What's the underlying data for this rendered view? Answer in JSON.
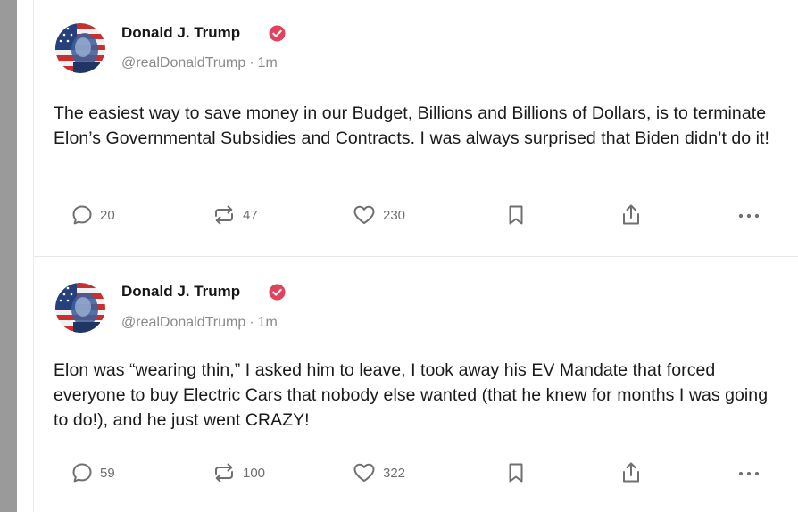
{
  "posts": [
    {
      "author_name": "Donald J. Trump",
      "handle": "@realDonaldTrump",
      "separator": "·",
      "time": "1m",
      "text": "The easiest way to save money in our Budget, Billions and Billions of Dollars, is to terminate Elon’s Governmental Subsidies and Contracts. I was always surprised that Biden didn’t do it!",
      "reply_count": "20",
      "repost_count": "47",
      "like_count": "230"
    },
    {
      "author_name": "Donald J. Trump",
      "handle": "@realDonaldTrump",
      "separator": "·",
      "time": "1m",
      "text": "Elon was “wearing thin,” I asked him to leave, I took away his EV Mandate that forced everyone to buy Electric Cars that nobody else wanted (that he knew for months I was going to do!), and he just went CRAZY!",
      "reply_count": "59",
      "repost_count": "100",
      "like_count": "322"
    }
  ],
  "icons": {
    "reply": "speech-bubble-icon",
    "repost": "repost-arrows-icon",
    "like": "heart-icon",
    "bookmark": "bookmark-icon",
    "share": "share-icon",
    "more": "more-dots-icon",
    "verified": "verified-badge-icon"
  },
  "colors": {
    "verified_badge": "#e0435b",
    "icon_gray": "#6f6f6f",
    "text": "#1a1a1a",
    "muted": "#8a8a8a",
    "rail": "#9a9a9a"
  }
}
